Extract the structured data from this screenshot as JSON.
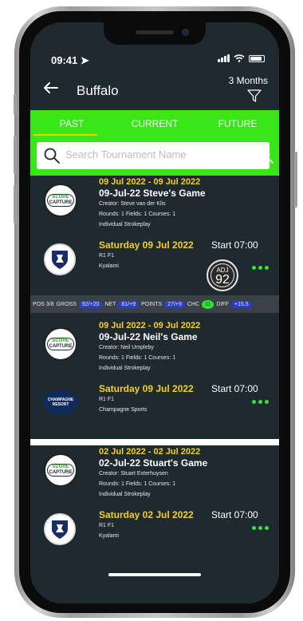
{
  "status_bar": {
    "time": "09:41",
    "location_arrow": "location-arrow-icon"
  },
  "header": {
    "back_icon": "back-arrow-icon",
    "title": "Buffalo",
    "period": "3 Months",
    "filter_icon": "filter-funnel-icon"
  },
  "tabs": [
    {
      "label": "PAST",
      "active": true
    },
    {
      "label": "CURRENT",
      "active": false
    },
    {
      "label": "FUTURE",
      "active": false
    }
  ],
  "search": {
    "placeholder": "Search Tournament Name"
  },
  "logos": {
    "score": "SCORE",
    "capture": "CAPTURE",
    "champagne": "CHAMPAGNE",
    "resort": "RESORT"
  },
  "games": [
    {
      "date_range": "09 Jul 2022 - 09 Jul 2022",
      "name": "09-Jul-22 Steve's Game",
      "creator": "Creator: Steve van der Klis",
      "rounds": "Rounds: 1 Fields: 1 Courses: 1",
      "format": "Individual Strokeplay",
      "round_date": "Saturday 09 Jul 2022",
      "start": "Start 07:00",
      "round_field": "R1 F1",
      "course": "Kyalami",
      "adj_label": "ADJ",
      "adj_value": "92",
      "stats": {
        "pos": "POS 3/8",
        "gross_label": "GROSS",
        "gross": "92/+20",
        "net_label": "NET",
        "net": "81/+9",
        "points_label": "POINTS",
        "points": "27/+9",
        "chc_label": "CHC",
        "chc": "11",
        "diff_label": "DIFF",
        "diff": "+15.5"
      }
    },
    {
      "date_range": "09 Jul 2022 - 09 Jul 2022",
      "name": "09-Jul-22 Neil's Game",
      "creator": "Creator: Neil Umpleby",
      "rounds": "Rounds: 1 Fields: 1 Courses: 1",
      "format": "Individual Strokeplay",
      "round_date": "Saturday 09 Jul 2022",
      "start": "Start 07:00",
      "round_field": "R1 F1",
      "course": "Champagne Sports"
    },
    {
      "date_range": "02 Jul 2022 - 02 Jul 2022",
      "name": "02-Jul-22 Stuart's Game",
      "creator": "Creator: Stuart Esterhuysen",
      "rounds": "Rounds: 1 Fields: 1 Courses: 1",
      "format": "Individual Strokeplay",
      "round_date": "Saturday 02 Jul 2022",
      "start": "Start 07:00",
      "round_field": "R1 F1",
      "course": "Kyalami"
    }
  ],
  "colors": {
    "background": "#1f2a30",
    "tab_bar": "#39e61a",
    "accent_yellow": "#f5d11c",
    "pill_blue": "#2b3bd6",
    "more_dots": "#2fe62f"
  }
}
